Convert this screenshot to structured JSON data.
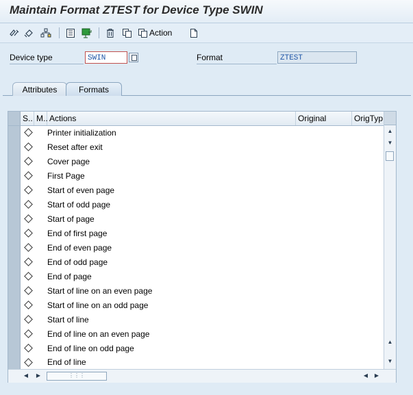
{
  "title": "Maintain Format ZTEST for Device Type SWIN",
  "toolbar": {
    "items": [
      "display-change-icon",
      "other-object-icon",
      "hierarchy-icon",
      "detail-icon",
      "transport-icon",
      "delete-icon",
      "copy-icon",
      "action-icon"
    ],
    "action_label": "Action"
  },
  "header": {
    "device_type_label": "Device type",
    "device_type_value": "SWIN",
    "format_label": "Format",
    "format_value": "ZTEST"
  },
  "tabs": [
    {
      "label": "Attributes",
      "active": false
    },
    {
      "label": "Formats",
      "active": true
    }
  ],
  "table": {
    "columns": [
      "S..",
      "M..",
      "Actions",
      "Original",
      "OrigTyp"
    ],
    "rows": [
      "Printer initialization",
      "Reset after exit",
      "Cover page",
      "First Page",
      "Start of even page",
      "Start of odd page",
      "Start of page",
      "End of first page",
      "End of even page",
      "End of odd page",
      "End of page",
      "Start of line on an even page",
      "Start of line on an odd page",
      "Start of line",
      "End of line on an even page",
      "End of line on odd page",
      "End of line"
    ]
  },
  "colors": {
    "background": "#dfebf5",
    "focus_border": "#c0504d",
    "value_text": "#1f56a8"
  }
}
